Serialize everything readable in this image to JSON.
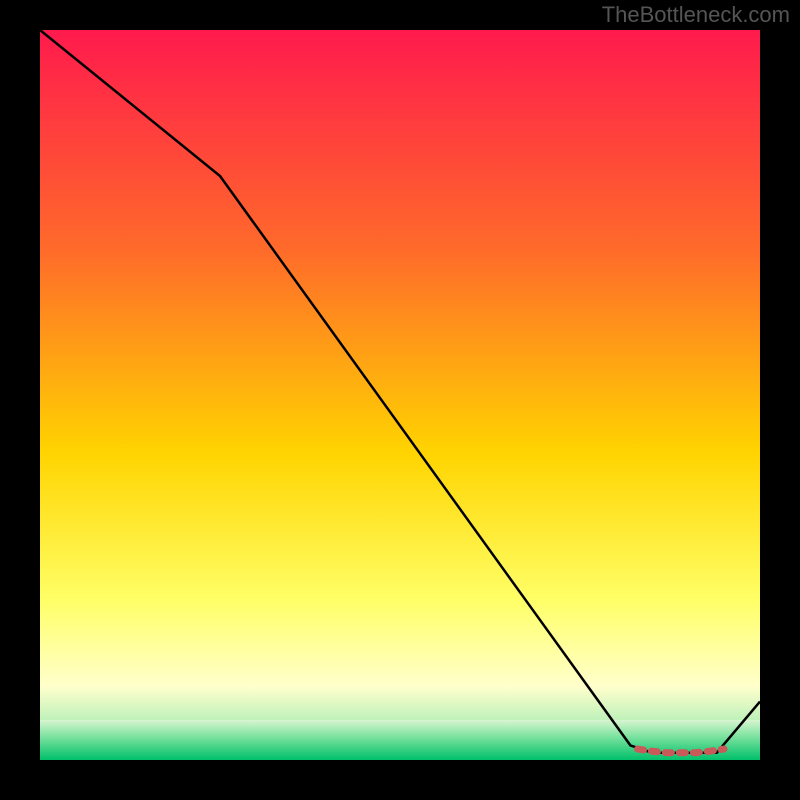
{
  "attribution": "TheBottleneck.com",
  "palette": {
    "gradient_top": "#ff1a4d",
    "gradient_mid1": "#ff6a2a",
    "gradient_mid2": "#ffd400",
    "gradient_lower": "#ffff66",
    "gradient_pale": "#ffffcc",
    "green_dark": "#00b060",
    "green_light": "#66e69e",
    "curve_main": "#000000",
    "curve_marker": "#c85a5a"
  },
  "chart_data": {
    "type": "line",
    "title": "",
    "xlabel": "",
    "ylabel": "",
    "xlim": [
      0,
      100
    ],
    "ylim": [
      0,
      100
    ],
    "series": [
      {
        "name": "bottleneck-curve",
        "x": [
          0,
          25,
          82,
          85,
          94,
          100
        ],
        "values": [
          100,
          80,
          2,
          1,
          1,
          8
        ]
      },
      {
        "name": "optimal-band",
        "x": [
          83,
          85,
          87,
          89,
          91,
          93,
          95
        ],
        "values": [
          1.5,
          1.2,
          1.0,
          1.0,
          1.0,
          1.2,
          1.5
        ]
      }
    ],
    "gradient_stops": [
      {
        "pct": 0,
        "color": "#ff1a4d"
      },
      {
        "pct": 30,
        "color": "#ff6a2a"
      },
      {
        "pct": 58,
        "color": "#ffd400"
      },
      {
        "pct": 78,
        "color": "#ffff66"
      },
      {
        "pct": 90,
        "color": "#ffffcc"
      },
      {
        "pct": 95,
        "color": "#b8f0b8"
      },
      {
        "pct": 100,
        "color": "#00c96e"
      }
    ]
  }
}
